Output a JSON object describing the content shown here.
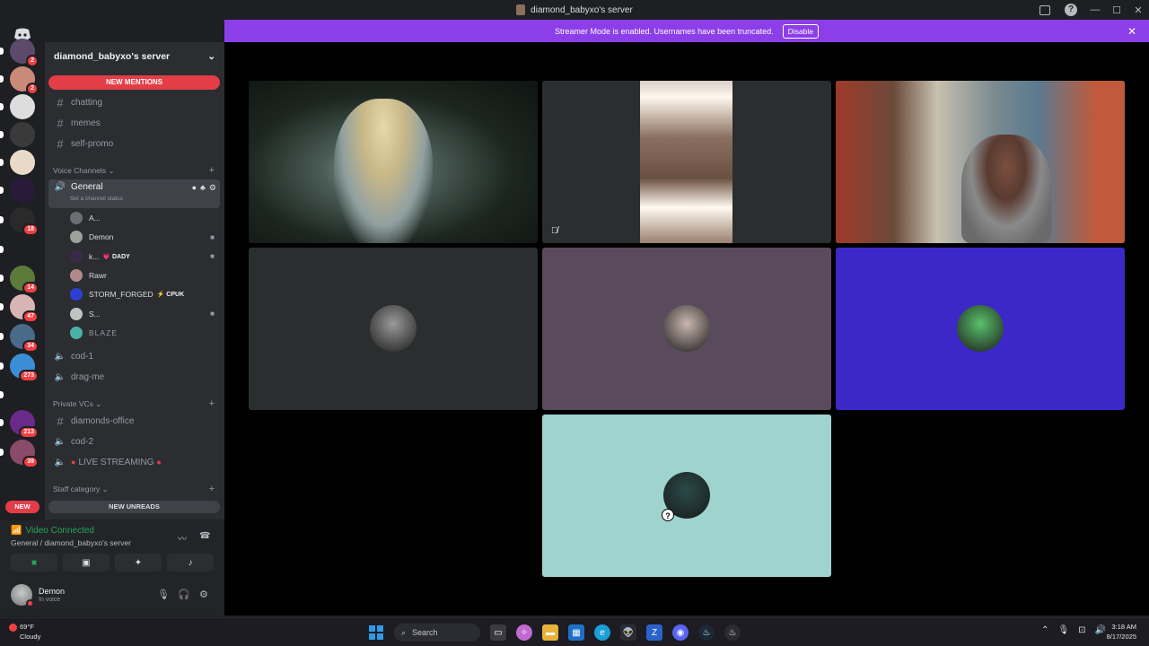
{
  "window": {
    "title": "diamond_babyxo's server"
  },
  "banner": {
    "text": "Streamer Mode is enabled. Usernames have been truncated.",
    "disable_label": "Disable"
  },
  "guilds": [
    {
      "color": "#5b4a6b",
      "badge": "2"
    },
    {
      "color": "#c98a7a",
      "badge": "2"
    },
    {
      "color": "#dddddd",
      "badge": ""
    },
    {
      "color": "#3a3a3a",
      "badge": ""
    },
    {
      "color": "#e8d9c9",
      "badge": ""
    },
    {
      "color": "#2a1a3a",
      "badge": ""
    },
    {
      "color": "#2a2a2a",
      "badge": "18"
    },
    {
      "color": "#1e1f22",
      "badge": ""
    },
    {
      "color": "#5c7a3a",
      "badge": "14"
    },
    {
      "color": "#d9b4b4",
      "badge": "47"
    },
    {
      "color": "#4a6a8a",
      "badge": "34"
    },
    {
      "color": "#3b8ed6",
      "badge": "273"
    },
    {
      "color": "#1e1f22",
      "badge": ""
    },
    {
      "color": "#6a2a8a",
      "badge": "213"
    },
    {
      "color": "#8a4a6a",
      "badge": "39"
    }
  ],
  "sidebar": {
    "server_name": "diamond_babyxo's server",
    "new_mentions": "NEW MENTIONS",
    "text_channels": [
      "chatting",
      "memes",
      "self-promo"
    ],
    "voice_category": "Voice Channels",
    "general": {
      "name": "General",
      "status": "Set a channel status"
    },
    "voice_users": [
      {
        "name": "A...",
        "tag": "",
        "color": "#6b6f74"
      },
      {
        "name": "Demon",
        "tag": "",
        "color": "#9aa29a"
      },
      {
        "name": "k...",
        "tag": "💗 DADY",
        "color": "#3a2a4a"
      },
      {
        "name": "Rawr",
        "tag": "",
        "color": "#b08a8a"
      },
      {
        "name": "STORM_FORGED",
        "tag": "⚡ CPUK",
        "color": "#2d3fd0"
      },
      {
        "name": "S...",
        "tag": "",
        "color": "#c0c4c0"
      },
      {
        "name": "BLAZE",
        "tag": "",
        "color": "#4ab0a8"
      }
    ],
    "voice_channels": [
      "cod-1",
      "drag-me"
    ],
    "private_category": "Private VCs",
    "private_channels": [
      "diamonds-office",
      "cod-2",
      "LIVE STREAMING"
    ],
    "staff_category": "Staff category",
    "new_unreads": "NEW UNREADS",
    "new_pill": "NEW"
  },
  "voice": {
    "status": "Video Connected",
    "location": "General / diamond_babyxo's server"
  },
  "user": {
    "name": "Demon",
    "status": "In voice"
  },
  "tiles": [
    {
      "kind": "cam1",
      "bg": "#1a201c",
      "speaking": false
    },
    {
      "kind": "cam2",
      "bg": "#2b2e2e",
      "speaking": false
    },
    {
      "kind": "cam3",
      "bg": "#6a5040",
      "speaking": true
    },
    {
      "kind": "avatar",
      "bg": "#2b2e2f",
      "avatar": "#9a9a9a",
      "speaking": false
    },
    {
      "kind": "avatar",
      "bg": "#5a4b5c",
      "avatar": "#c9b7b0",
      "speaking": false
    },
    {
      "kind": "avatar",
      "bg": "#3c28c8",
      "avatar": "#5ac06a",
      "speaking": false
    },
    {
      "kind": "avatar",
      "bg": "#9ed4cd",
      "avatar": "#2a4a4a",
      "speaking": false
    }
  ],
  "taskbar": {
    "temp": "69°F",
    "weather": "Cloudy",
    "search": "Search",
    "time": "3:18 AM",
    "date": "8/17/2025"
  }
}
